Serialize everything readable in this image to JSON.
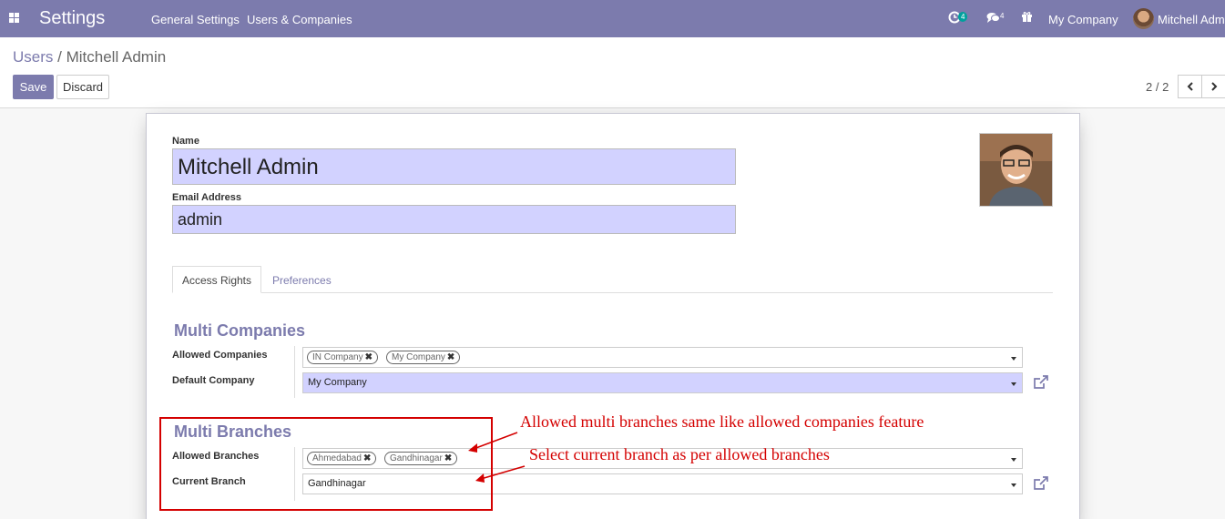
{
  "navbar": {
    "brand": "Settings",
    "menu": [
      "General Settings",
      "Users & Companies"
    ],
    "activity_count": "4",
    "messages_count": "4",
    "company": "My Company",
    "user": "Mitchell Admin"
  },
  "breadcrumb": {
    "parent": "Users",
    "separator": "/",
    "current": "Mitchell Admin"
  },
  "buttons": {
    "save": "Save",
    "discard": "Discard"
  },
  "pager": {
    "value": "2 / 2"
  },
  "form": {
    "name_label": "Name",
    "name_value": "Mitchell Admin",
    "email_label": "Email Address",
    "email_value": "admin"
  },
  "tabs": [
    "Access Rights",
    "Preferences"
  ],
  "multi_companies": {
    "title": "Multi Companies",
    "allowed_label": "Allowed Companies",
    "allowed_tags": [
      "IN Company",
      "My Company"
    ],
    "default_label": "Default Company",
    "default_value": "My Company"
  },
  "multi_branches": {
    "title": "Multi Branches",
    "allowed_label": "Allowed Branches",
    "allowed_tags": [
      "Ahmedabad",
      "Gandhinagar"
    ],
    "current_label": "Current Branch",
    "current_value": "Gandhinagar"
  },
  "annotations": {
    "note1": "Allowed multi branches same like allowed companies feature",
    "note2": "Select current branch as per allowed branches"
  },
  "colors": {
    "navbar": "#7c7bad",
    "required_field": "#d2d2ff",
    "annotation": "#d40000"
  }
}
